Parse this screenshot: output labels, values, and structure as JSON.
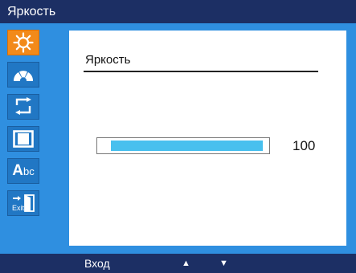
{
  "window": {
    "title": "Яркость"
  },
  "sidebar": {
    "items": [
      {
        "icon": "brightness-sun-icon",
        "active": true
      },
      {
        "icon": "color-palette-icon",
        "active": false
      },
      {
        "icon": "swap-arrows-icon",
        "active": false
      },
      {
        "icon": "screen-frame-icon",
        "active": false
      },
      {
        "icon": "language-abc-icon",
        "label": "Abc",
        "active": false
      },
      {
        "icon": "exit-door-icon",
        "label": "Exit",
        "active": false
      }
    ]
  },
  "panel": {
    "title": "Яркость",
    "value": "100",
    "level": 1.0
  },
  "footer": {
    "enter_label": "Вход",
    "up_arrow": "▲",
    "down_arrow": "▼"
  },
  "colors": {
    "title_bar": "#1c2f64",
    "menu_background": "#2f8fe0",
    "active_item": "#f28a1a",
    "bar_fill": "#48c0ee"
  }
}
